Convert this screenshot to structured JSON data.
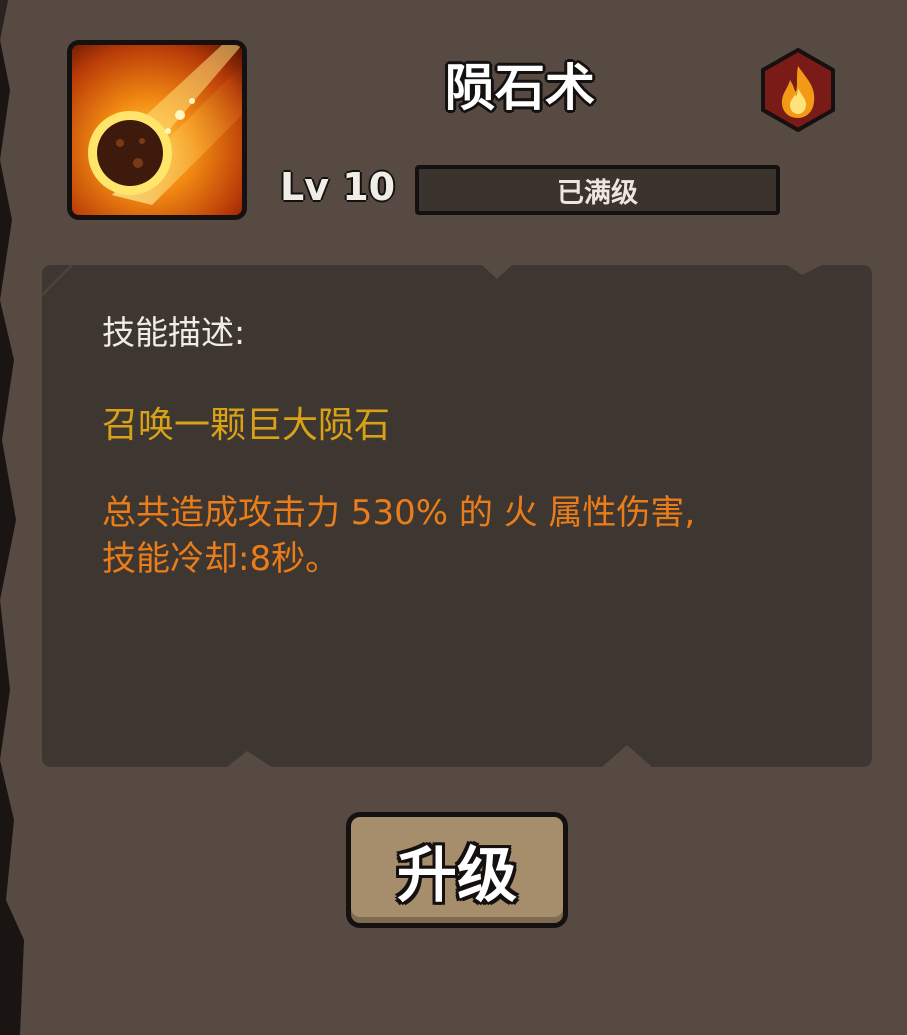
{
  "skill": {
    "name": "陨石术",
    "icon": "meteor-icon",
    "element_icon": "fire-element-icon",
    "level_label": "Lv 10",
    "level_status": "已满级"
  },
  "description": {
    "heading": "技能描述:",
    "summary": "召唤一颗巨大陨石",
    "detail_line1": "总共造成攻击力 530% 的 火 属性伤害,",
    "detail_line2": "技能冷却:8秒。"
  },
  "actions": {
    "upgrade_label": "升级"
  },
  "colors": {
    "panel": "#574a42",
    "desc_box": "#3e3731",
    "summary_text": "#d9a116",
    "detail_text": "#ea7d1a",
    "element_badge": "#7a1b18",
    "button": "#a68d6c"
  }
}
